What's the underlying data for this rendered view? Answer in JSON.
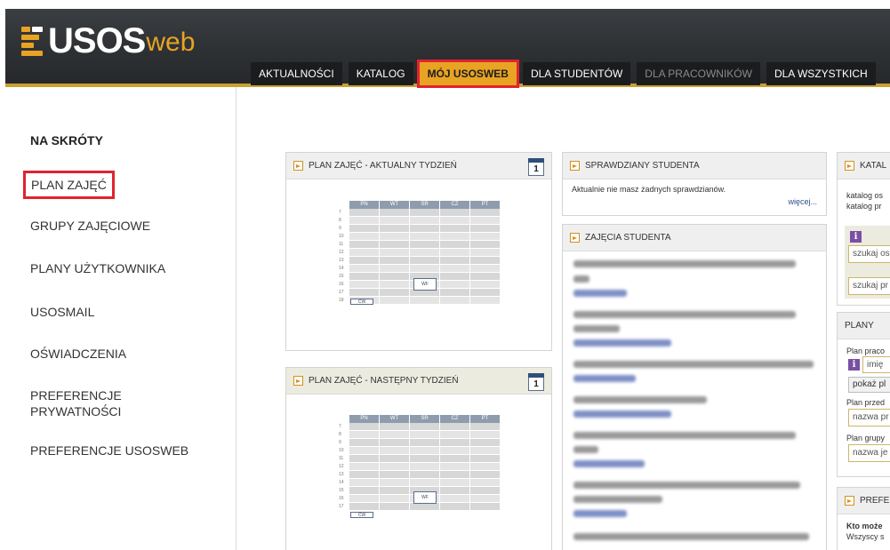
{
  "logo": {
    "usos": "USOS",
    "web": "web"
  },
  "nav": [
    {
      "label": "AKTUALNOŚCI"
    },
    {
      "label": "KATALOG"
    },
    {
      "label": "MÓJ USOSWEB"
    },
    {
      "label": "DLA STUDENTÓW"
    },
    {
      "label": "DLA PRACOWNIKÓW"
    },
    {
      "label": "DLA WSZYSTKICH"
    }
  ],
  "sidebar": {
    "title": "NA SKRÓTY",
    "items": [
      {
        "label": "PLAN ZAJĘĆ"
      },
      {
        "label": "GRUPY ZAJĘCIOWE"
      },
      {
        "label": "PLANY UŻYTKOWNIKA"
      },
      {
        "label": "USOSMAIL"
      },
      {
        "label": "OŚWIADCZENIA"
      },
      {
        "label": "PREFERENCJE PRYWATNOŚCI"
      },
      {
        "label": "PREFERENCJE USOSWEB"
      }
    ]
  },
  "plan_current": {
    "title": "PLAN ZAJĘĆ - AKTUALNY TYDZIEŃ",
    "calendar_day": "1",
    "days": [
      "PN",
      "WT",
      "ŚR",
      "CZ",
      "PT"
    ],
    "hours": [
      "7",
      "8",
      "9",
      "10",
      "11",
      "12",
      "13",
      "14",
      "15",
      "16",
      "17",
      "18"
    ],
    "events": [
      "WF",
      "CW"
    ]
  },
  "plan_next": {
    "title": "PLAN ZAJĘĆ - NASTĘPNY TYDZIEŃ",
    "calendar_day": "1",
    "days": [
      "PN",
      "WT",
      "ŚR",
      "CZ",
      "PT"
    ],
    "hours": [
      "7",
      "8",
      "9",
      "10",
      "11",
      "12",
      "13",
      "14",
      "15",
      "16",
      "17"
    ],
    "events": [
      "WF",
      "CW"
    ]
  },
  "tests": {
    "title": "SPRAWDZIANY STUDENTA",
    "message": "Aktualnie nie masz żadnych sprawdzianów.",
    "more": "więcej..."
  },
  "courses": {
    "title": "ZAJĘCIA STUDENTA"
  },
  "catalog": {
    "title": "KATAL",
    "line1": "katalog os",
    "line2": "katalog pr",
    "input1": "szukaj os",
    "input2": "szukaj pr"
  },
  "plans": {
    "title": "PLANY",
    "label1": "Plan praco",
    "input1": "imię",
    "button1": "pokaż pl",
    "label2": "Plan przed",
    "input2": "nazwa pr",
    "label3": "Plan grupy",
    "input3": "nazwa je"
  },
  "prefs": {
    "title": "PREFE",
    "bold": "Kto może",
    "text": "Wszyscy s"
  },
  "colors": {
    "accent": "#e8a323",
    "highlight": "#e0232f",
    "header": "#2e3134"
  }
}
